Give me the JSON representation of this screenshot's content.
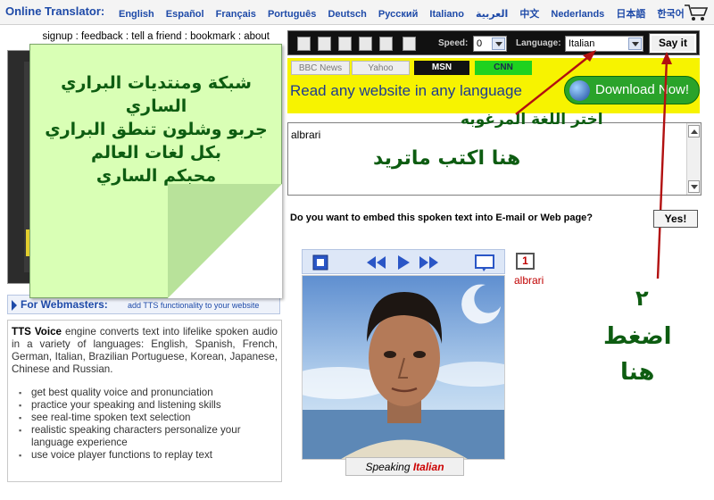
{
  "brand": "Online Translator:",
  "languages": [
    "English",
    "Español",
    "Français",
    "Português",
    "Deutsch",
    "Русский",
    "Italiano",
    "العربية",
    "中文",
    "Nederlands",
    "日本語",
    "한국어"
  ],
  "links": [
    "signup",
    "feedback",
    "tell a friend",
    "bookmark",
    "about"
  ],
  "sticky_note": {
    "lines": [
      "شبكة ومنتديات البراري",
      "الساري",
      "جربو وشلون تنطق البراري",
      "بكل لغات العالم",
      "محبكم الساري"
    ]
  },
  "webmasters": {
    "title": "For Webmasters:",
    "subtitle": "add TTS functionality to your website"
  },
  "tts": {
    "title": "TTS Voice",
    "description": "engine converts text into lifelike spoken audio in a variety of languages: English, Spanish, French, German, Italian, Brazilian Portuguese, Korean, Japanese, Chinese and Russian.",
    "bullets": [
      "get best quality voice and pronunciation",
      "practice your speaking and listening skills",
      "see real-time spoken text selection",
      "realistic speaking characters personalize your language experience",
      "use voice player functions to replay text"
    ]
  },
  "toolbar": {
    "speed_label": "Speed:",
    "speed_value": "0",
    "language_label": "Language:",
    "language_value": "Italian",
    "say_it": "Say it"
  },
  "banner": {
    "tabs": [
      "BBC News",
      "Yahoo",
      "MSN",
      "CNN"
    ],
    "headline": "Read any website in any language",
    "download": "Download Now!"
  },
  "text_input": {
    "value": "albrari"
  },
  "annotations": {
    "choose_language": "اختر اللغة المرغوبه",
    "type_here": "هنا اكتب ماتريد",
    "step_number": "٢",
    "press": "اضغط",
    "here": "هنا"
  },
  "embed": {
    "question": "Do you want to embed this spoken text into E-mail or Web page?",
    "yes": "Yes!"
  },
  "player": {
    "counter": "1",
    "name": "albrari",
    "speaking_label": "Speaking",
    "speaking_language": "Italian"
  }
}
